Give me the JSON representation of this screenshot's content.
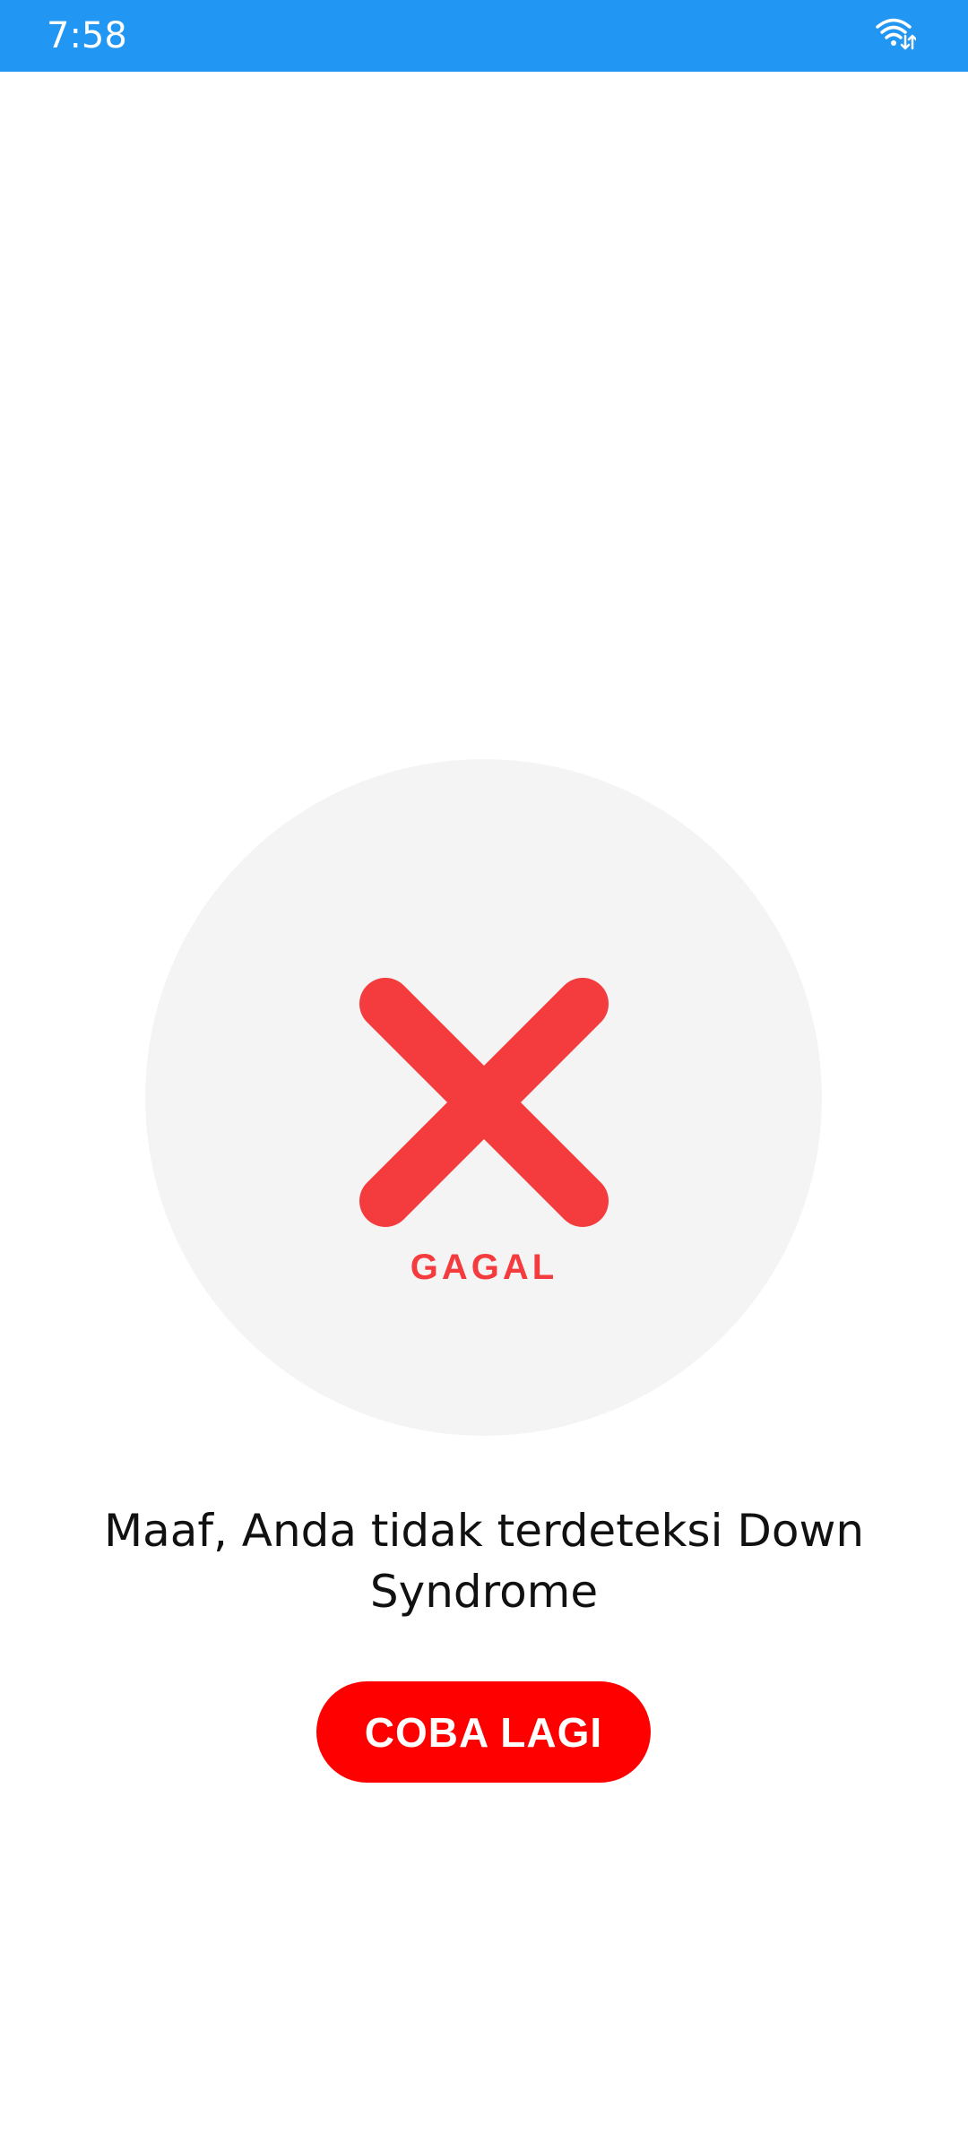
{
  "status_bar": {
    "time": "7:58",
    "color": "#2196F3",
    "icons": [
      "wifi-icon"
    ]
  },
  "result": {
    "icon": "close-icon",
    "icon_color": "#f43b3e",
    "label": "GAGAL",
    "message": "Maaf, Anda tidak terdeteksi Down Syndrome"
  },
  "actions": {
    "retry_label": "COBA LAGI",
    "retry_color": "#ff0000"
  }
}
